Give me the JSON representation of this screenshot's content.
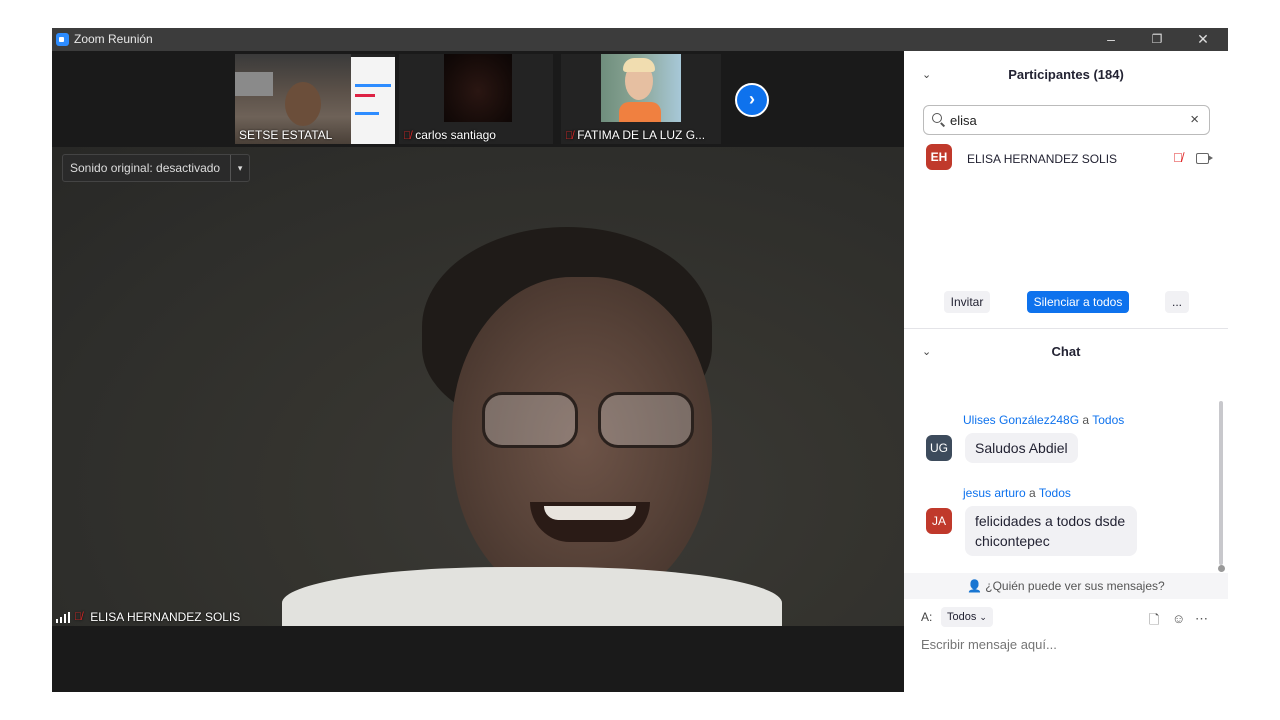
{
  "titlebar": {
    "title": "Zoom Reunión",
    "minimize": "–",
    "restore": "❐",
    "close": "✕"
  },
  "strip": {
    "thumbs": [
      {
        "name": "SETSE ESTATAL",
        "muted": false
      },
      {
        "name": "carlos santiago",
        "muted": true
      },
      {
        "name": "FATIMA DE LA LUZ G...",
        "muted": true
      }
    ],
    "next": "›"
  },
  "main_video": {
    "sound": "Sonido original: desactivado",
    "sound_caret": "▾",
    "speaker": "ELISA HERNANDEZ SOLIS"
  },
  "participants": {
    "title": "Participantes (184)",
    "search_value": "elisa",
    "list": [
      {
        "initials": "EH",
        "name": "ELISA HERNANDEZ SOLIS",
        "color": "#c0392b"
      }
    ],
    "invite": "Invitar",
    "mute_all": "Silenciar a todos",
    "more": "..."
  },
  "chat": {
    "title": "Chat",
    "messages": [
      {
        "initials": "UG",
        "from": "Ulises González248G",
        "a": "a",
        "to": "Todos",
        "text": "Saludos Abdiel",
        "color": "#3d4b5c"
      },
      {
        "initials": "JA",
        "from": "jesus arturo",
        "a": "a",
        "to": "Todos",
        "text": "felicidades a todos dsde chicontepec",
        "color": "#c0392b"
      }
    ],
    "who_can_see": "¿Quién puede ver sus mensajes?",
    "to_label": "A:",
    "to_value": "Todos",
    "placeholder": "Escribir mensaje aquí..."
  },
  "colors": {
    "accent": "#0e72ed",
    "muted_mic": "#e02828",
    "titlebar": "#3c3c3c"
  }
}
